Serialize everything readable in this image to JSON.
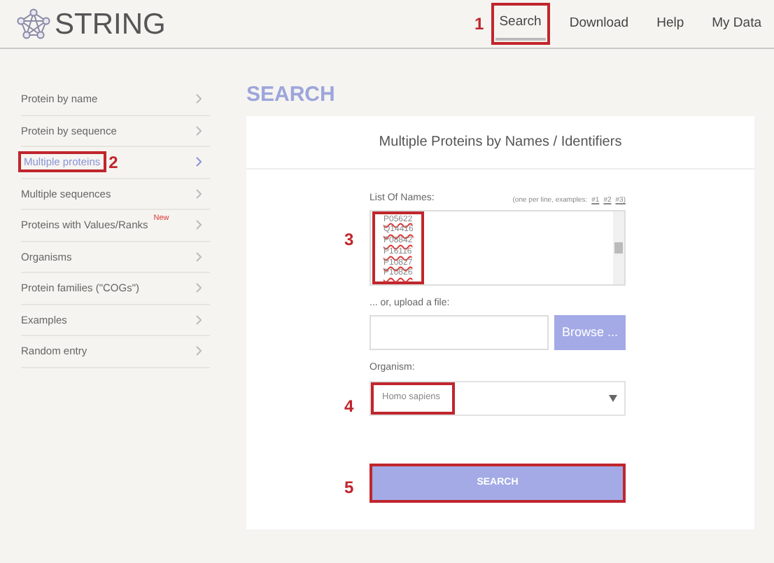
{
  "header": {
    "logo": "STRING",
    "nav": [
      {
        "label": "Search",
        "selected": true,
        "annotation": "1"
      },
      {
        "label": "Download",
        "selected": false
      },
      {
        "label": "Help",
        "selected": false
      },
      {
        "label": "My Data",
        "selected": false
      }
    ]
  },
  "sidebar": {
    "items": [
      {
        "label": "Protein by name",
        "selected": false
      },
      {
        "label": "Protein by sequence",
        "selected": false
      },
      {
        "label": "Multiple proteins",
        "selected": true,
        "annotation": "2"
      },
      {
        "label": "Multiple sequences",
        "selected": false
      },
      {
        "label": "Proteins with Values/Ranks",
        "badge": "New",
        "selected": false
      },
      {
        "label": "Organisms",
        "selected": false
      },
      {
        "label": "Protein families (\"COGs\")",
        "selected": false
      },
      {
        "label": "Examples",
        "selected": false
      },
      {
        "label": "Random entry",
        "selected": false
      }
    ]
  },
  "main": {
    "heading": "SEARCH",
    "card_title": "Multiple Proteins by Names / Identifiers",
    "list_label": "List Of Names:",
    "list_hint": "(one per line, examples:",
    "examples": [
      "#1",
      "#2",
      "#3)"
    ],
    "list_values": [
      "P05622",
      "Q14416",
      "P08842",
      "P16116",
      "P10827",
      "P10826"
    ],
    "list_annotation": "3",
    "upload_label": "... or, upload a file:",
    "browse_button": "Browse ...",
    "organism_label": "Organism:",
    "organism_value": "Homo sapiens",
    "organism_annotation": "4",
    "search_button": "SEARCH",
    "search_annotation": "5"
  }
}
